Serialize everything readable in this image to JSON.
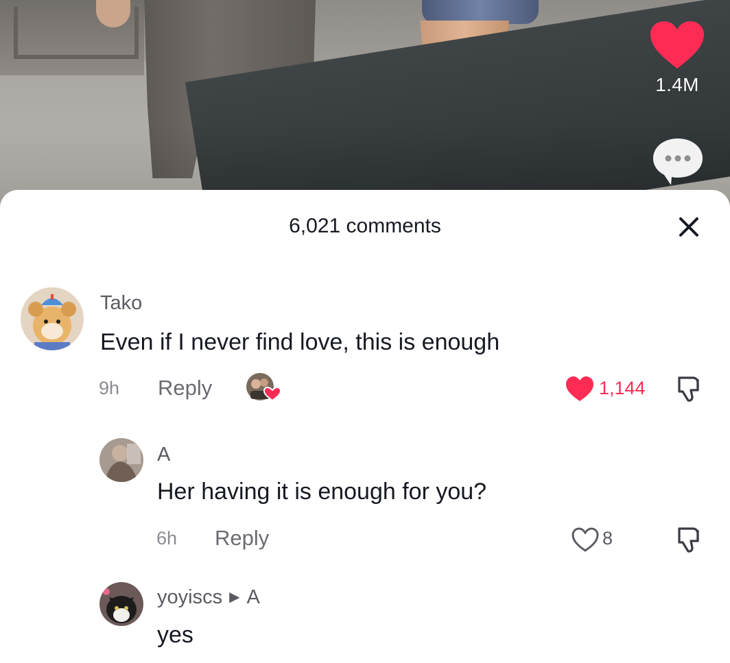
{
  "video": {
    "like_count": "1.4M"
  },
  "comments_panel": {
    "title": "6,021 comments"
  },
  "comments": [
    {
      "username": "Tako",
      "text": "Even if I never find love, this is enough",
      "time": "9h",
      "reply_label": "Reply",
      "likes": "1,144",
      "liked": true
    },
    {
      "username": "A",
      "text": "Her having it is enough for you?",
      "time": "6h",
      "reply_label": "Reply",
      "likes": "8",
      "liked": false
    },
    {
      "username": "yoyiscs",
      "reply_to": "A",
      "text": "yes"
    }
  ],
  "colors": {
    "like_red": "#fe2c55",
    "text_primary": "#161823",
    "text_secondary": "#8a8b91"
  },
  "icons": {
    "like": "heart-icon",
    "comment": "comment-bubble-icon",
    "close": "close-icon",
    "dislike": "thumbs-down-icon",
    "creator_liked": "creator-liked-badge"
  }
}
